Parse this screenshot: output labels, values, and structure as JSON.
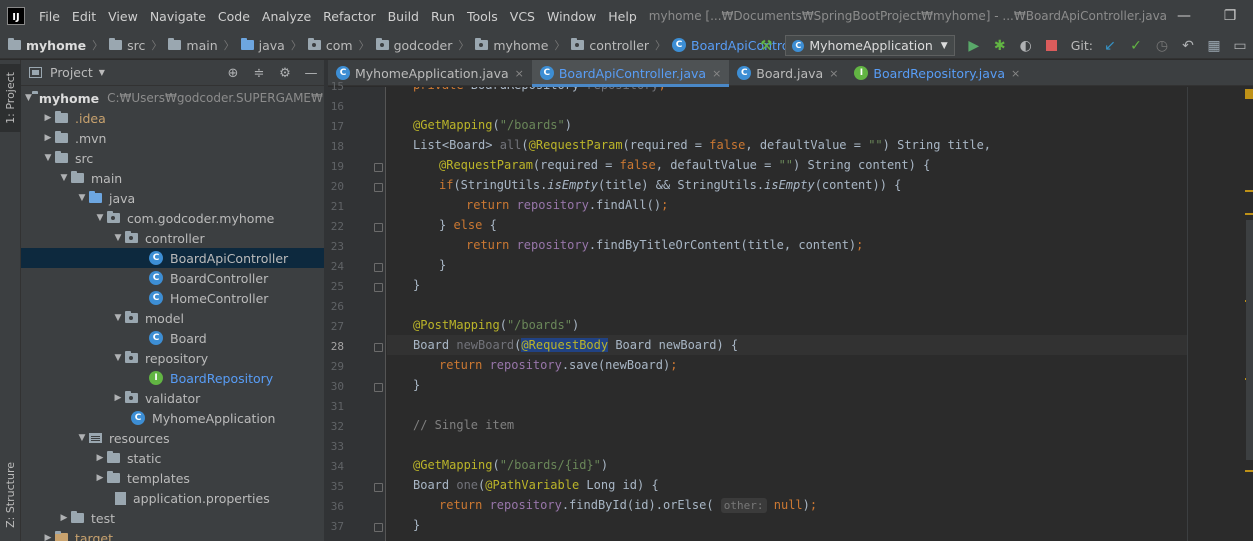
{
  "titlebar": {
    "logo": "IJ",
    "menu": [
      "File",
      "Edit",
      "View",
      "Navigate",
      "Code",
      "Analyze",
      "Refactor",
      "Build",
      "Run",
      "Tools",
      "VCS",
      "Window",
      "Help"
    ],
    "title": "myhome [...₩Documents₩SpringBootProject₩myhome] - ...₩BoardApiController.java",
    "minimize": "—",
    "maximize": "❐"
  },
  "breadcrumb": {
    "items": [
      "myhome",
      "src",
      "main",
      "java",
      "com",
      "godcoder",
      "myhome",
      "controller",
      "BoardApiController"
    ],
    "class_letter": "C"
  },
  "toolbar": {
    "run_config": "MyhomeApplication",
    "git_label": "Git:"
  },
  "left_strip": {
    "project_tab": "1: Project",
    "structure_tab": "Z: Structure"
  },
  "project_panel": {
    "title": "Project",
    "root_name": "myhome",
    "root_path": "C:₩Users₩godcoder.SUPERGAME₩Do",
    "tree": [
      {
        "label": "myhome",
        "depth": 0
      },
      {
        "label": ".idea",
        "depth": 1
      },
      {
        "label": ".mvn",
        "depth": 1
      },
      {
        "label": "src",
        "depth": 1
      },
      {
        "label": "main",
        "depth": 2
      },
      {
        "label": "java",
        "depth": 3
      },
      {
        "label": "com.godcoder.myhome",
        "depth": 4
      },
      {
        "label": "controller",
        "depth": 5
      },
      {
        "label": "BoardApiController",
        "depth": 6
      },
      {
        "label": "BoardController",
        "depth": 6
      },
      {
        "label": "HomeController",
        "depth": 6
      },
      {
        "label": "model",
        "depth": 5
      },
      {
        "label": "Board",
        "depth": 6
      },
      {
        "label": "repository",
        "depth": 5
      },
      {
        "label": "BoardRepository",
        "depth": 6
      },
      {
        "label": "validator",
        "depth": 5
      },
      {
        "label": "MyhomeApplication",
        "depth": 5
      },
      {
        "label": "resources",
        "depth": 3
      },
      {
        "label": "static",
        "depth": 4
      },
      {
        "label": "templates",
        "depth": 4
      },
      {
        "label": "application.properties",
        "depth": 4
      },
      {
        "label": "test",
        "depth": 2
      },
      {
        "label": "target",
        "depth": 1
      }
    ]
  },
  "editor": {
    "tabs": [
      {
        "name": "MyhomeApplication.java",
        "active": false
      },
      {
        "name": "BoardApiController.java",
        "active": true
      },
      {
        "name": "Board.java",
        "active": false
      },
      {
        "name": "BoardRepository.java",
        "active": false
      }
    ],
    "close_glyph": "×",
    "current_line": 28,
    "line_numbers": [
      15,
      16,
      17,
      18,
      19,
      20,
      21,
      22,
      23,
      24,
      25,
      26,
      27,
      28,
      29,
      30,
      31,
      32,
      33,
      34,
      35,
      36,
      37
    ],
    "code": {
      "l15_private": "private",
      "l15_type": " BoardRepository",
      "l15_field": " repository",
      "l15_end": ";",
      "l17_ann": "@GetMapping",
      "l17_open": "(",
      "l17_str": "\"/boards\"",
      "l17_close": ")",
      "l18_type": "List<Board> ",
      "l18_fn": "all",
      "l18_open": "(",
      "l18_ann": "@RequestParam",
      "l18_p1": "(required = ",
      "l18_false": "false",
      "l18_p2": ", defaultValue = ",
      "l18_str": "\"\"",
      "l18_p3": ") String title,",
      "l19_ann": "@RequestParam",
      "l19_p1": "(required = ",
      "l19_false": "false",
      "l19_p2": ", defaultValue = ",
      "l19_str": "\"\"",
      "l19_p3": ") String content) {",
      "l20_if": "if",
      "l20_p1": "(StringUtils.",
      "l20_m1": "isEmpty",
      "l20_p2": "(title) && StringUtils.",
      "l20_m2": "isEmpty",
      "l20_p3": "(content)) {",
      "l21_ret": "return ",
      "l21_fld": "repository",
      "l21_rest": ".findAll()",
      "l21_semi": ";",
      "l22_brace": "} ",
      "l22_else": "else",
      "l22_open": " {",
      "l23_ret": "return ",
      "l23_fld": "repository",
      "l23_rest": ".findByTitleOrContent(title, content)",
      "l23_semi": ";",
      "l24": "}",
      "l25": "}",
      "l27_ann": "@PostMapping",
      "l27_open": "(",
      "l27_str": "\"/boards\"",
      "l27_close": ")",
      "l28_type": "Board ",
      "l28_fn": "newBoard",
      "l28_open": "(",
      "l28_ann": "@RequestBody",
      "l28_rest": " Board newBoard) {",
      "l29_ret": "return ",
      "l29_fld": "repository",
      "l29_rest": ".save(newBoard)",
      "l29_semi": ";",
      "l30": "}",
      "l32_comment": "// Single item",
      "l34_ann": "@GetMapping",
      "l34_open": "(",
      "l34_str": "\"/boards/{id}\"",
      "l34_close": ")",
      "l35_type": "Board ",
      "l35_fn": "one",
      "l35_open": "(",
      "l35_ann": "@PathVariable",
      "l35_rest": " Long id) {",
      "l36_ret": "return ",
      "l36_fld": "repository",
      "l36_rest": ".findById(id).orElse( ",
      "l36_hint": "other:",
      "l36_null": " null",
      "l36_close": ")",
      "l36_semi": ";",
      "l37": "}"
    }
  }
}
